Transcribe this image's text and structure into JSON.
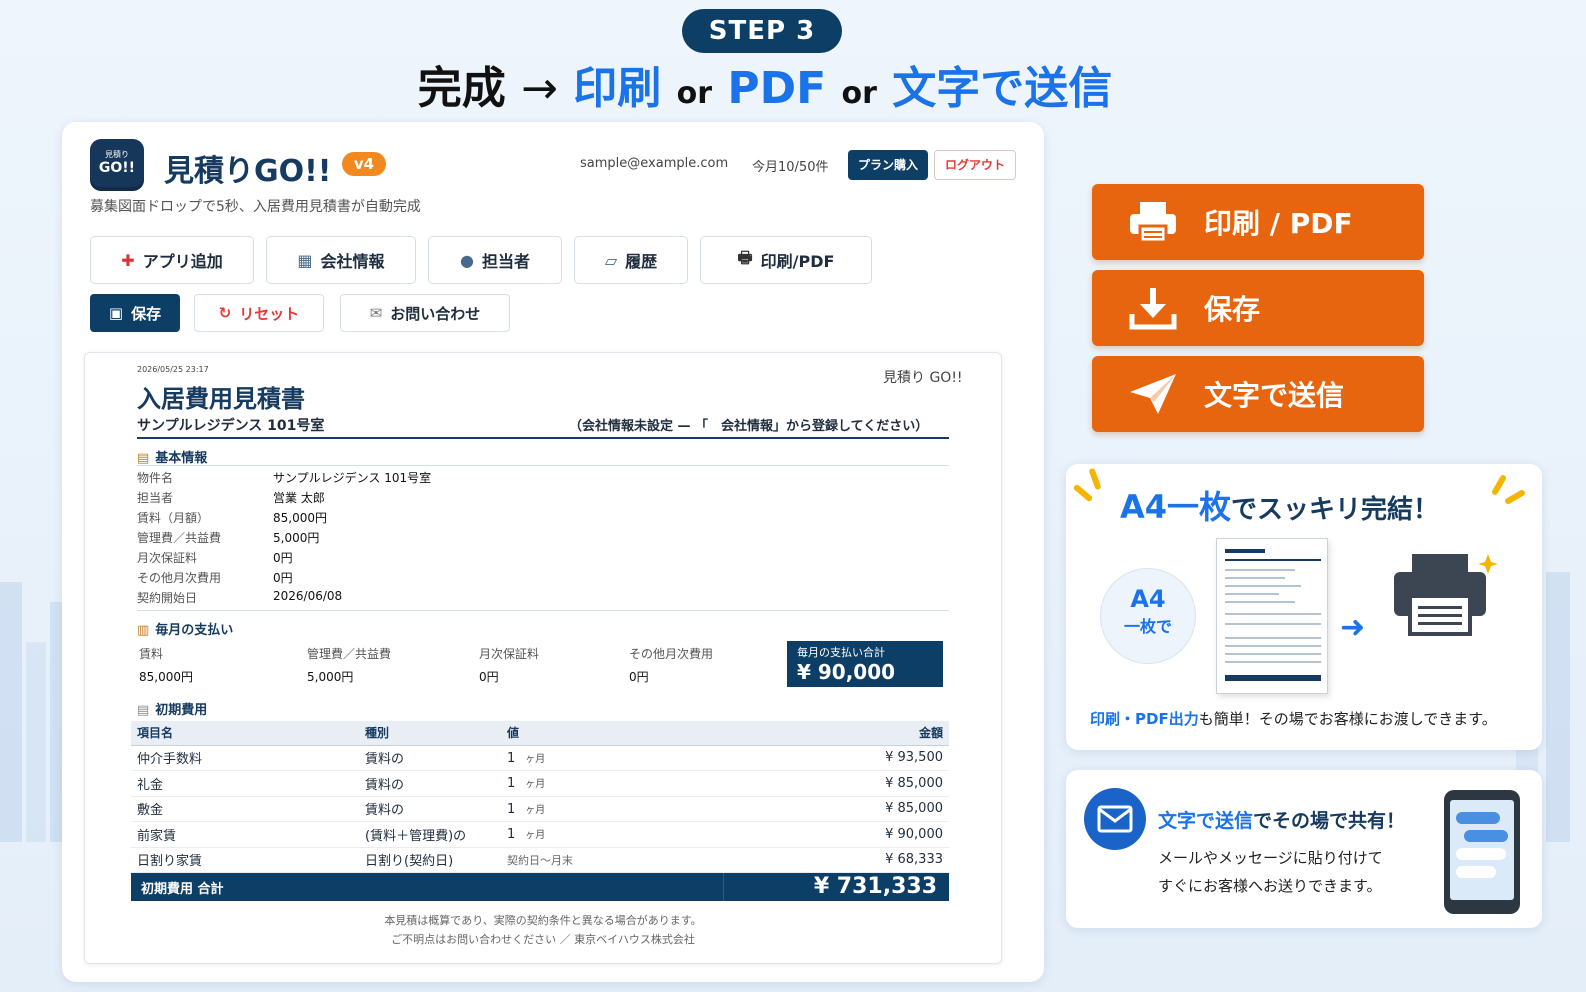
{
  "header": {
    "step": "STEP 3",
    "headline_parts": [
      "完成",
      "→",
      "印刷",
      "or",
      "PDF",
      "or",
      "文字で送信"
    ]
  },
  "app": {
    "logo_line1": "見積り",
    "logo_line2": "GO!!",
    "title": "見積りGO!!",
    "version": "v4",
    "subtitle": "募集図面ドロップで5秒、入居費用見積書が自動完成",
    "user_email": "sample@example.com",
    "usage": "今月10/50件",
    "plan_button": "プラン購入",
    "logout_button": "ログアウト",
    "toolbar": [
      {
        "label": "アプリ追加",
        "icon": "plus-icon"
      },
      {
        "label": "会社情報",
        "icon": "building-icon"
      },
      {
        "label": "担当者",
        "icon": "person-icon"
      },
      {
        "label": "履歴",
        "icon": "history-icon"
      },
      {
        "label": "印刷/PDF",
        "icon": "printer-icon"
      }
    ],
    "save_button": "保存",
    "reset_button": "リセット",
    "contact_button": "お問い合わせ"
  },
  "doc": {
    "date": "2026/05/25 23:17",
    "brand": "見積り GO!!",
    "title": "入居費用見積書",
    "property": "サンプルレジデンス 101号室",
    "company_note": "（会社情報未設定 — 「　会社情報」から登録してください）",
    "basic_heading": "基本情報",
    "basic_info": [
      {
        "k": "物件名",
        "v": "サンプルレジデンス 101号室"
      },
      {
        "k": "担当者",
        "v": "営業 太郎"
      },
      {
        "k": "賃料（月額）",
        "v": "85,000円"
      },
      {
        "k": "管理費／共益費",
        "v": "5,000円"
      },
      {
        "k": "月次保証料",
        "v": "0円"
      },
      {
        "k": "その他月次費用",
        "v": "0円"
      },
      {
        "k": "契約開始日",
        "v": "2026/06/08"
      }
    ],
    "monthly_heading": "毎月の支払い",
    "monthly": [
      {
        "k": "賃料",
        "v": "85,000円"
      },
      {
        "k": "管理費／共益費",
        "v": "5,000円"
      },
      {
        "k": "月次保証料",
        "v": "0円"
      },
      {
        "k": "その他月次費用",
        "v": "0円"
      }
    ],
    "monthly_total_label": "毎月の支払い合計",
    "monthly_total": "¥ 90,000",
    "initial_heading": "初期費用",
    "table_headers": [
      "項目名",
      "種別",
      "値",
      "金額"
    ],
    "rows": [
      {
        "name": "仲介手数料",
        "type": "賃料の",
        "value": "1",
        "unit": "ヶ月",
        "amount": "¥ 93,500"
      },
      {
        "name": "礼金",
        "type": "賃料の",
        "value": "1",
        "unit": "ヶ月",
        "amount": "¥ 85,000"
      },
      {
        "name": "敷金",
        "type": "賃料の",
        "value": "1",
        "unit": "ヶ月",
        "amount": "¥ 85,000"
      },
      {
        "name": "前家賃",
        "type": "(賃料＋管理費)の",
        "value": "1",
        "unit": "ヶ月",
        "amount": "¥ 90,000"
      },
      {
        "name": "日割り家賃",
        "type": "日割り(契約日)",
        "value": "契約日〜月末",
        "unit": "",
        "amount": "¥ 68,333"
      }
    ],
    "total_label": "初期費用 合計",
    "total": "¥ 731,333",
    "footer_line1": "本見積は概算であり、実際の契約条件と異なる場合があります。",
    "footer_line2": "ご不明点はお問い合わせください ／ 東京ベイハウス株式会社"
  },
  "actions": {
    "print_pdf": "印刷 / PDF",
    "save": "保存",
    "send_text": "文字で送信"
  },
  "promo1": {
    "title_highlight": "A4一枚",
    "title_rest": "でスッキリ完結！",
    "badge_line1": "A4",
    "badge_line2": "一枚で",
    "caption_highlight": "印刷・PDF出力",
    "caption_rest": "も簡単！その場でお客様にお渡しできます。"
  },
  "promo2": {
    "title_highlight": "文字で送信",
    "title_rest": "でその場で共有！",
    "line1": "メールやメッセージに貼り付けて",
    "line2": "すぐにお客様へお送りできます。"
  },
  "colors": {
    "navy": "#0d3f66",
    "accent_orange": "#e8650f",
    "accent_blue": "#1a73e8",
    "badge_orange": "#f2891f",
    "danger_red": "#e53935"
  }
}
